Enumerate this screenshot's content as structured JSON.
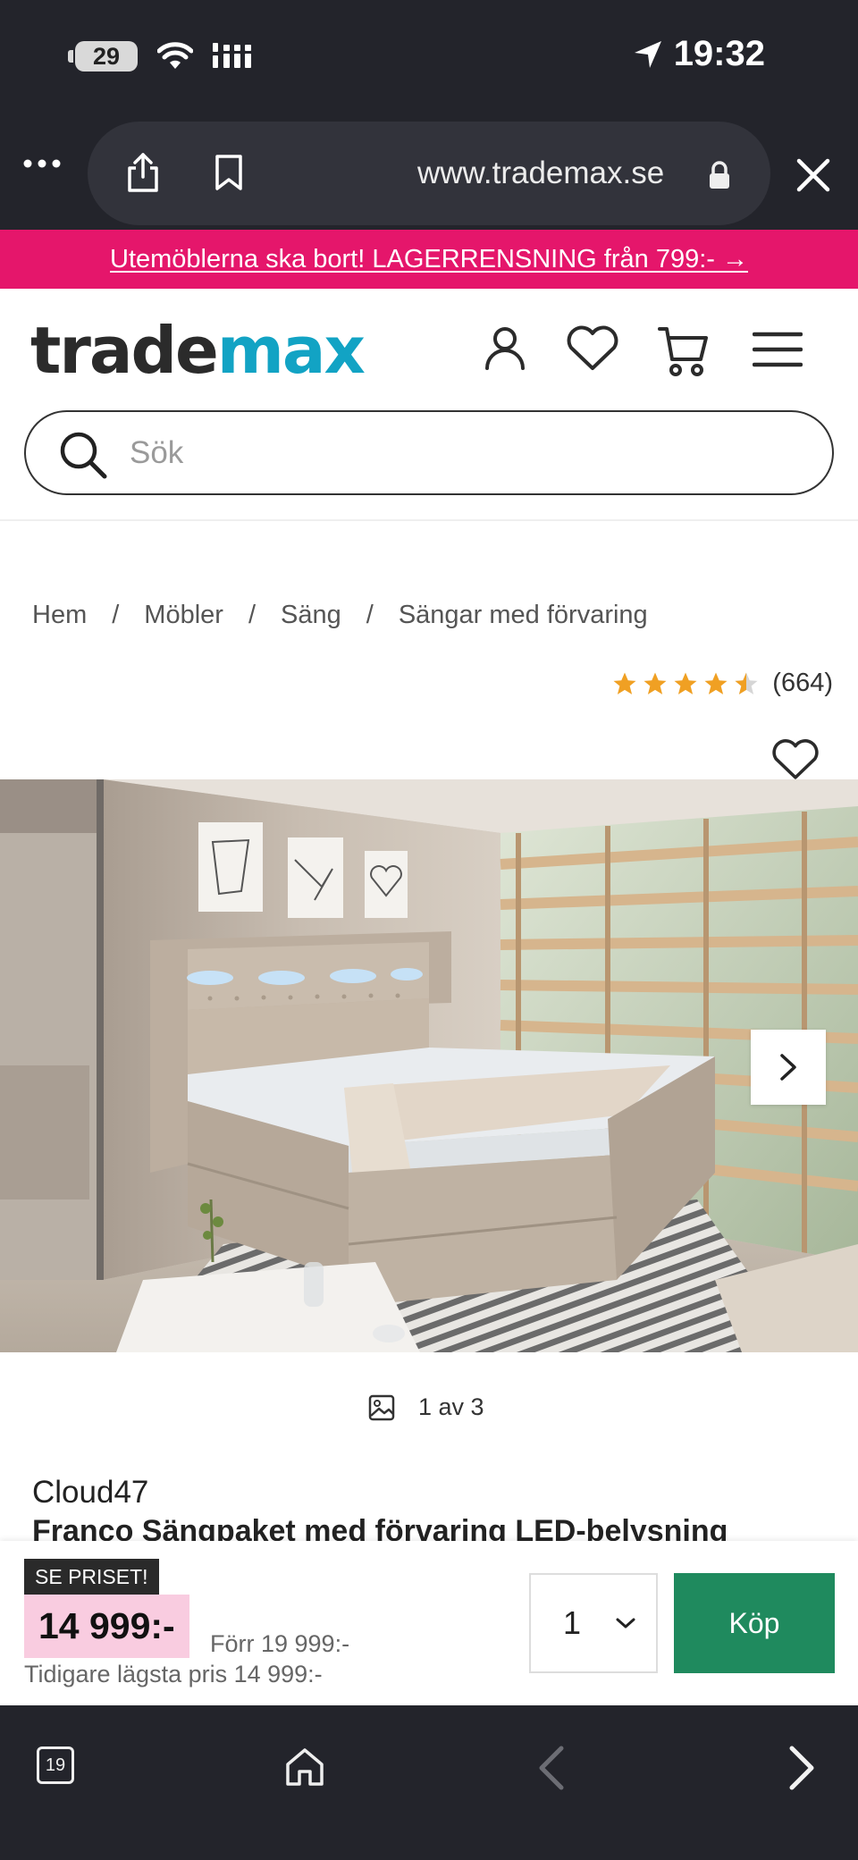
{
  "status_bar": {
    "battery": "29",
    "time": "19:32"
  },
  "browser": {
    "url": "www.trademax.se"
  },
  "promo": {
    "text": "Utemöblerna ska bort! LAGERRENSNING från 799:- →"
  },
  "header": {
    "logo_part1": "trade",
    "logo_part2": "max",
    "search_placeholder": "Sök"
  },
  "breadcrumb": [
    "Hem",
    "Möbler",
    "Säng",
    "Sängar med förvaring"
  ],
  "rating": {
    "stars": 4.5,
    "count": "(664)"
  },
  "gallery": {
    "counter": "1 av 3"
  },
  "product": {
    "brand": "Cloud47",
    "title": "Franco Sängpaket med förvaring LED-belysning"
  },
  "buybar": {
    "badge": "SE PRISET!",
    "price": "14 999:-",
    "before_price": "Förr 19 999:-",
    "lowest_price": "Tidigare lägsta pris 14 999:-",
    "quantity": "1",
    "buy_label": "Köp"
  },
  "bottom_bar": {
    "tabs_count": "19"
  },
  "colors": {
    "promo": "#e5166b",
    "logo_accent": "#12a3c4",
    "buy_button": "#1f8a5e",
    "price_highlight": "#f9cce0",
    "star": "#f0a023"
  }
}
